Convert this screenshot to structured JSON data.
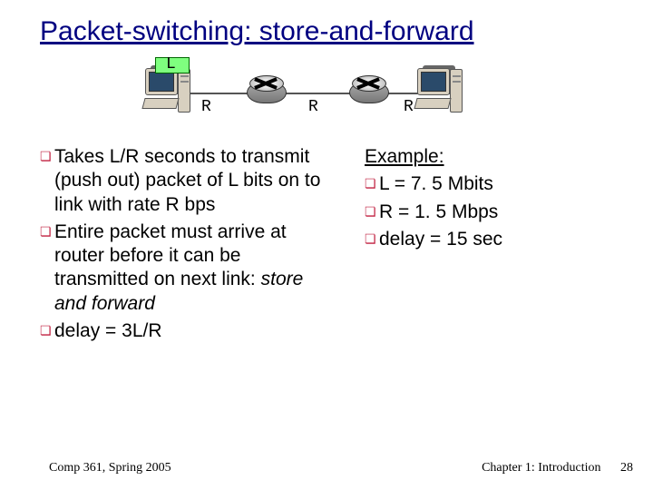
{
  "title": "Packet-switching: store-and-forward",
  "diagram": {
    "packet_label": "L",
    "r1": "R",
    "r2": "R",
    "r3": "R"
  },
  "left_bullets": [
    {
      "pre": "Takes L/R seconds to transmit (push out) packet of L bits on to link with rate R bps",
      "em": ""
    },
    {
      "pre": "Entire packet must arrive at router before it can be transmitted on next link: ",
      "em": "store and forward"
    },
    {
      "pre": "delay = 3L/R",
      "em": ""
    }
  ],
  "example": {
    "header": "Example:",
    "items": [
      "L = 7. 5 Mbits",
      "R = 1. 5 Mbps",
      "delay = 15 sec"
    ]
  },
  "footer": {
    "left": "Comp 361,    Spring 2005",
    "chapter": "Chapter 1: Introduction",
    "page": "28"
  }
}
